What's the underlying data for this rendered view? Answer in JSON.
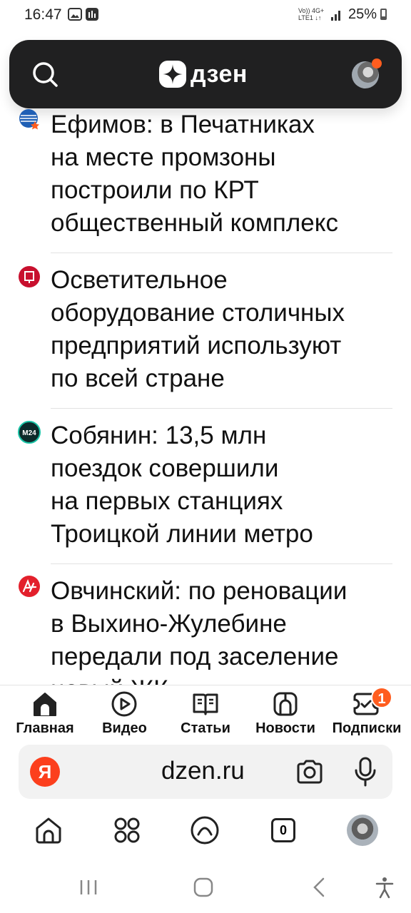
{
  "status_bar": {
    "time": "16:47",
    "network_top": "Vo)) 4G+",
    "network_bottom": "LTE1 ↓↑",
    "battery": "25%"
  },
  "header": {
    "logo_text": "дзен",
    "icons": [
      "search-icon",
      "dzen-logo-icon",
      "avatar"
    ],
    "notification_color": "#ff5d1f"
  },
  "feed": {
    "items": [
      {
        "source_icon": "source-mos-icon",
        "headline_lines": [
          "Ефимов: в Печатниках",
          "на месте промзоны",
          "построили по КРТ",
          "общественный комплекс"
        ]
      },
      {
        "source_icon": "source-red-icon",
        "headline_lines": [
          "Осветительное",
          "оборудование столичных",
          "предприятий используют",
          "по всей стране"
        ]
      },
      {
        "source_icon": "source-m24-icon",
        "source_label": "M24",
        "headline_lines": [
          "Собянин: 13,5 млн",
          "поездок совершили",
          "на первых станциях",
          "Троицкой линии метро"
        ]
      },
      {
        "source_icon": "source-aif-icon",
        "headline_lines": [
          "Овчинский: по реновации",
          "в Выхино-Жулебине",
          "передали под заселение",
          "новый ЖК"
        ]
      }
    ]
  },
  "tabs": [
    {
      "label": "Главная",
      "icon": "home-icon"
    },
    {
      "label": "Видео",
      "icon": "video-icon"
    },
    {
      "label": "Статьи",
      "icon": "articles-icon"
    },
    {
      "label": "Новости",
      "icon": "news-icon"
    },
    {
      "label": "Подписки",
      "icon": "subscriptions-icon",
      "badge": "1"
    }
  ],
  "browser": {
    "ya_letter": "Я",
    "url": "dzen.ru",
    "tab_count": "0"
  },
  "colors": {
    "accent": "#ff5d1f",
    "header_bg": "#202021",
    "yandex_red": "#fc3f1d"
  }
}
